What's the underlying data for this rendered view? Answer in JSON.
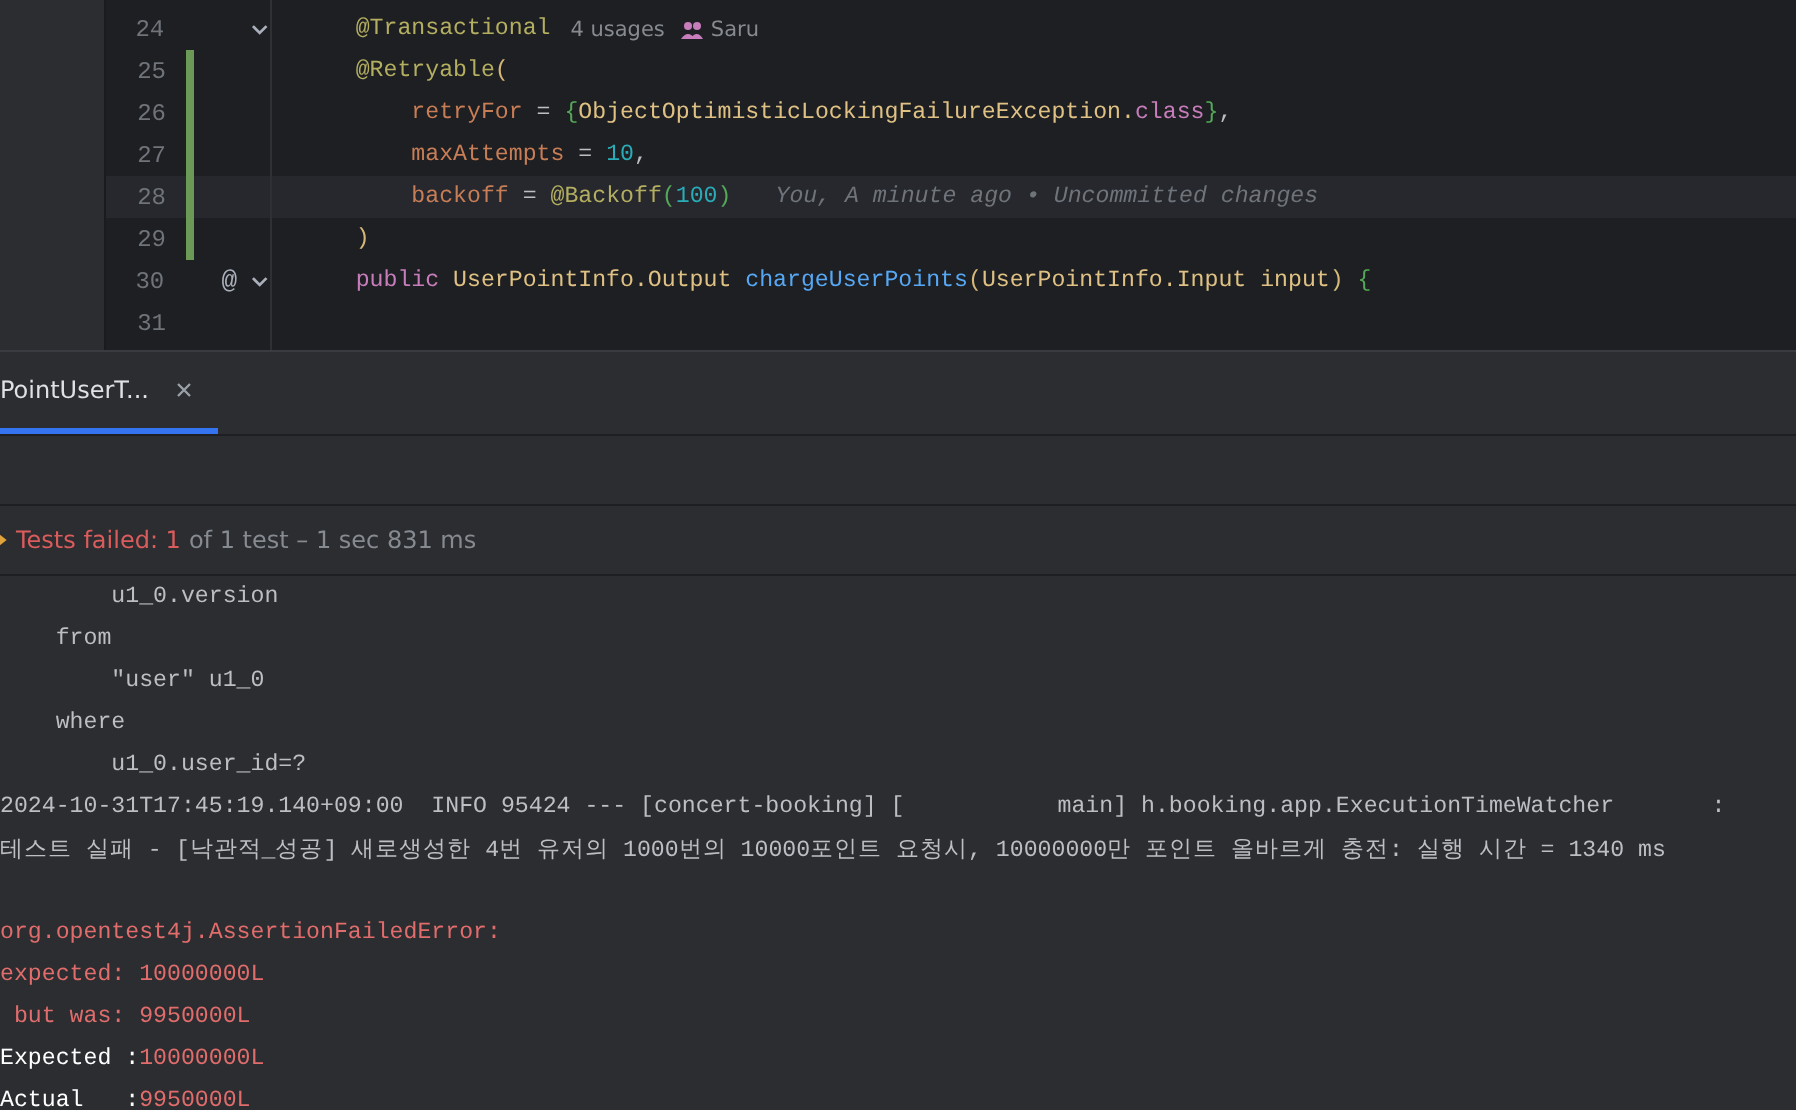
{
  "editor": {
    "lines": [
      {
        "number": "24",
        "fold": true,
        "changed": false,
        "current": false,
        "segments": [
          {
            "kind": "annotation",
            "text": "    @Transactional"
          }
        ],
        "hints": [
          {
            "kind": "usages",
            "text": "4 usages"
          },
          {
            "kind": "author",
            "text": "Saru"
          }
        ]
      },
      {
        "number": "25",
        "fold": false,
        "changed": true,
        "current": false,
        "segments": [
          {
            "kind": "annotation",
            "text": "    @Retryable"
          },
          {
            "kind": "paren",
            "text": "("
          }
        ]
      },
      {
        "number": "26",
        "fold": false,
        "changed": true,
        "current": false,
        "segments": [
          {
            "kind": "param",
            "text": "        retryFor"
          },
          {
            "kind": "plain",
            "text": " = "
          },
          {
            "kind": "brace",
            "text": "{"
          },
          {
            "kind": "type",
            "text": "ObjectOptimisticLockingFailureException."
          },
          {
            "kind": "keyword",
            "text": "class"
          },
          {
            "kind": "brace",
            "text": "}"
          },
          {
            "kind": "plain",
            "text": ","
          }
        ]
      },
      {
        "number": "27",
        "fold": false,
        "changed": true,
        "current": false,
        "segments": [
          {
            "kind": "param",
            "text": "        maxAttempts"
          },
          {
            "kind": "plain",
            "text": " = "
          },
          {
            "kind": "number",
            "text": "10"
          },
          {
            "kind": "plain",
            "text": ","
          }
        ]
      },
      {
        "number": "28",
        "fold": false,
        "changed": true,
        "current": true,
        "segments": [
          {
            "kind": "param",
            "text": "        backoff"
          },
          {
            "kind": "plain",
            "text": " = "
          },
          {
            "kind": "annotation",
            "text": "@Backoff"
          },
          {
            "kind": "brace",
            "text": "("
          },
          {
            "kind": "number",
            "text": "100"
          },
          {
            "kind": "brace",
            "text": ")"
          }
        ],
        "hints": [
          {
            "kind": "blame",
            "text": "You, A minute ago • Uncommitted changes"
          }
        ]
      },
      {
        "number": "29",
        "fold": false,
        "changed": true,
        "current": false,
        "segments": [
          {
            "kind": "paren",
            "text": "    )"
          }
        ]
      },
      {
        "number": "30",
        "fold": true,
        "gutter_mark": "@",
        "changed": false,
        "current": false,
        "segments": [
          {
            "kind": "keyword",
            "text": "    public "
          },
          {
            "kind": "type",
            "text": "UserPointInfo.Output "
          },
          {
            "kind": "method",
            "text": "chargeUserPoints"
          },
          {
            "kind": "paren",
            "text": "("
          },
          {
            "kind": "type",
            "text": "UserPointInfo.Input input"
          },
          {
            "kind": "paren",
            "text": ") "
          },
          {
            "kind": "brace",
            "text": "{"
          }
        ]
      },
      {
        "number": "31",
        "fold": false,
        "changed": false,
        "current": false
      }
    ]
  },
  "run_panel": {
    "tabs": [
      {
        "label": "PointUserT...",
        "selected": true
      }
    ],
    "status": {
      "failed": "Tests failed: 1",
      "rest": "of 1 test – 1 sec 831 ms"
    },
    "console": [
      {
        "segments": [
          {
            "kind": "sql",
            "text": "        u1_0.version"
          }
        ]
      },
      {
        "segments": [
          {
            "kind": "sql",
            "text": "    from"
          }
        ]
      },
      {
        "segments": [
          {
            "kind": "sql",
            "text": "        \"user\" u1_0"
          }
        ]
      },
      {
        "segments": [
          {
            "kind": "sql",
            "text": "    where"
          }
        ]
      },
      {
        "segments": [
          {
            "kind": "sql",
            "text": "        u1_0.user_id=?"
          }
        ]
      },
      {
        "segments": [
          {
            "kind": "log",
            "text": "2024-10-31T17:45:19.140+09:00  INFO 95424 --- [concert-booking] [           main] h.booking.app.ExecutionTimeWatcher       :"
          }
        ]
      },
      {
        "segments": [
          {
            "kind": "log",
            "text": "테스트 실패 - [낙관적_성공] 새로생성한 4번 유저의 1000번의 10000포인트 요청시, 10000000만 포인트 올바르게 충전: 실행 시간 = 1340 ms"
          }
        ]
      },
      {
        "gap_before": true,
        "segments": [
          {
            "kind": "error",
            "text": "org.opentest4j.AssertionFailedError:"
          }
        ]
      },
      {
        "segments": [
          {
            "kind": "error",
            "text": "expected: 10000000L"
          }
        ]
      },
      {
        "segments": [
          {
            "kind": "error",
            "text": " but was: 9950000L"
          }
        ]
      },
      {
        "segments": [
          {
            "kind": "label",
            "text": "Expected :"
          },
          {
            "kind": "error",
            "text": "10000000L"
          }
        ]
      },
      {
        "segments": [
          {
            "kind": "label",
            "text": "Actual   :"
          },
          {
            "kind": "error",
            "text": "9950000L"
          }
        ]
      }
    ]
  }
}
